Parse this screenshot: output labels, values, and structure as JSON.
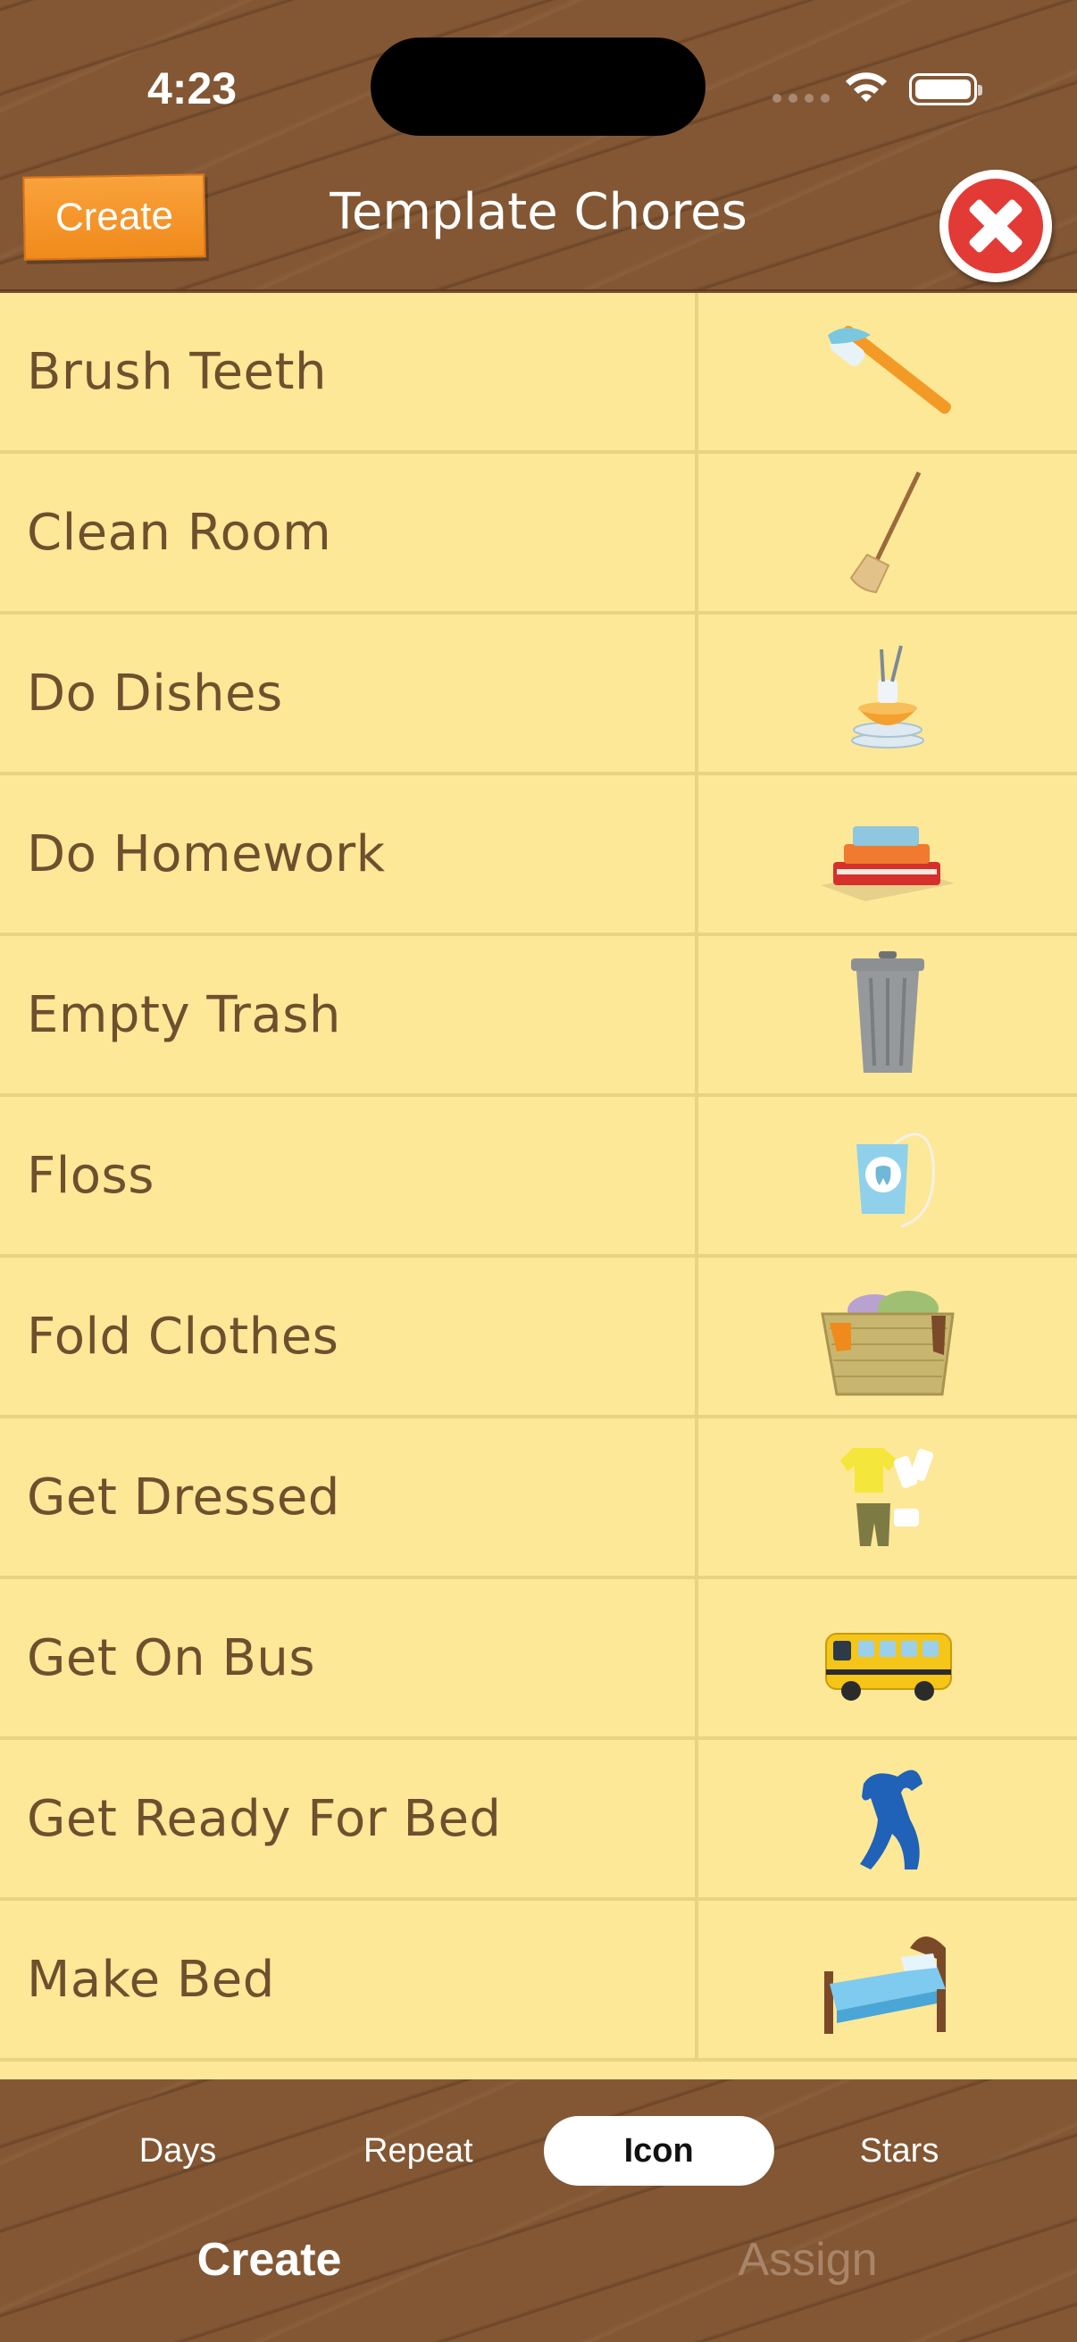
{
  "status_bar": {
    "time": "4:23"
  },
  "header": {
    "create_label": "Create",
    "title": "Template Chores"
  },
  "chores": [
    {
      "label": "Brush Teeth",
      "icon": "toothbrush-icon"
    },
    {
      "label": "Clean Room",
      "icon": "broom-icon"
    },
    {
      "label": "Do Dishes",
      "icon": "dishes-icon"
    },
    {
      "label": "Do Homework",
      "icon": "books-icon"
    },
    {
      "label": "Empty Trash",
      "icon": "trash-can-icon"
    },
    {
      "label": "Floss",
      "icon": "floss-icon"
    },
    {
      "label": "Fold Clothes",
      "icon": "laundry-basket-icon"
    },
    {
      "label": "Get Dressed",
      "icon": "clothes-icon"
    },
    {
      "label": "Get On Bus",
      "icon": "school-bus-icon"
    },
    {
      "label": "Get Ready For Bed",
      "icon": "pajamas-icon"
    },
    {
      "label": "Make Bed",
      "icon": "bed-icon"
    }
  ],
  "segments": {
    "items": [
      "Days",
      "Repeat",
      "Icon",
      "Stars"
    ],
    "selected": "Icon"
  },
  "tabs": {
    "create": "Create",
    "assign": "Assign"
  },
  "colors": {
    "wood": "#835734",
    "list_bg": "#fde898",
    "accent_orange": "#f08a1c",
    "close_red": "#e23b35",
    "label_text": "#6e4f2e"
  }
}
